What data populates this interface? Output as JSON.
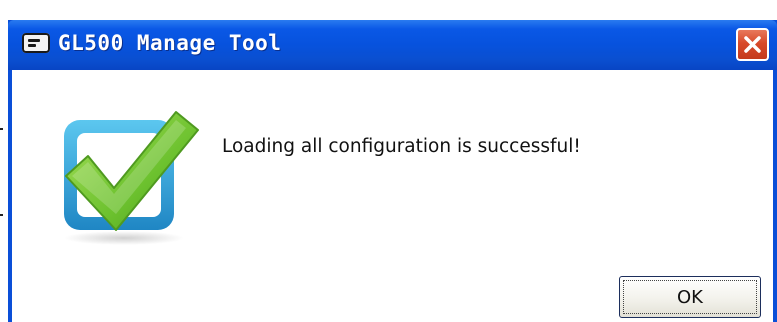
{
  "window": {
    "title": "GL500 Manage Tool",
    "icon": "app-window-icon",
    "close_icon": "close-icon"
  },
  "dialog": {
    "icon": "checkmark-success-icon",
    "message": "Loading all configuration is successful!",
    "ok_label": "OK"
  },
  "colors": {
    "titlebar": "#0752dd",
    "close_button": "#d84a2a",
    "check_green": "#6cc12e",
    "check_frame": "#2d9bd6"
  }
}
